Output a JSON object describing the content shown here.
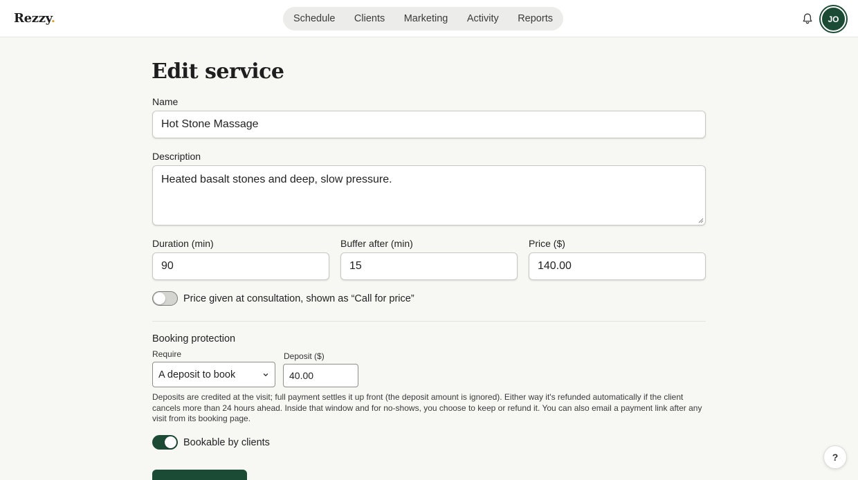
{
  "app": {
    "logo": "Rezzy",
    "logo_dot": "."
  },
  "nav": {
    "items": [
      {
        "label": "Schedule"
      },
      {
        "label": "Clients"
      },
      {
        "label": "Marketing"
      },
      {
        "label": "Activity"
      },
      {
        "label": "Reports"
      }
    ]
  },
  "user": {
    "initials": "JO"
  },
  "page": {
    "title": "Edit service"
  },
  "form": {
    "name_label": "Name",
    "name_value": "Hot Stone Massage",
    "description_label": "Description",
    "description_value": "Heated basalt stones and deep, slow pressure.",
    "duration_label": "Duration (min)",
    "duration_value": "90",
    "buffer_label": "Buffer after (min)",
    "buffer_value": "15",
    "price_label": "Price ($)",
    "price_value": "140.00",
    "consultation_toggle_label": "Price given at consultation, shown as “Call for price”",
    "consultation_toggle_on": false
  },
  "booking_protection": {
    "title": "Booking protection",
    "require_label": "Require",
    "require_value": "A deposit to book",
    "deposit_label": "Deposit ($)",
    "deposit_value": "40.00",
    "help_text": "Deposits are credited at the visit; full payment settles it up front (the deposit amount is ignored). Either way it's refunded automatically if the client cancels more than 24 hours ahead. Inside that window and for no-shows, you choose to keep or refund it. You can also email a payment link after any visit from its booking page."
  },
  "bookable": {
    "label": "Bookable by clients",
    "on": true
  },
  "help_button": {
    "label": "?"
  },
  "colors": {
    "accent": "#1b4a35",
    "logo_dot": "#d8a02c",
    "background": "#f7f7f4"
  },
  "icons": {
    "notifications": "bell-icon",
    "select_chevron": "chevron-down-icon"
  }
}
